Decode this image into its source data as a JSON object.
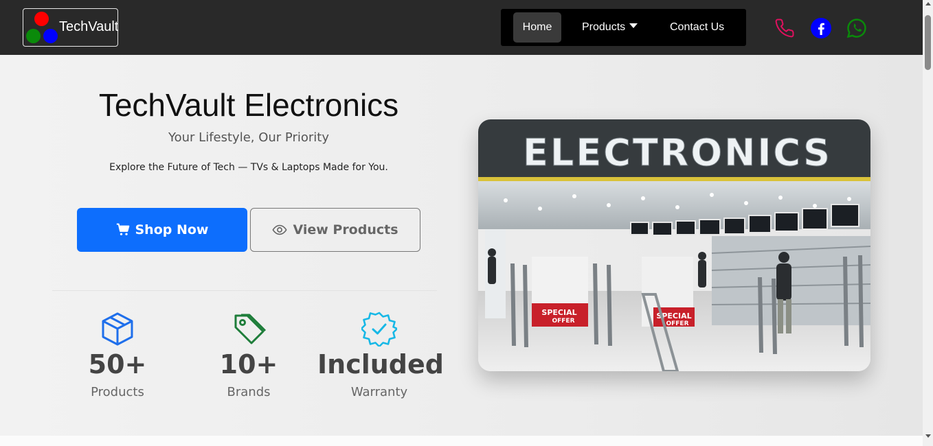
{
  "brand": {
    "name": "TechVault"
  },
  "nav": {
    "home": "Home",
    "products": "Products",
    "contact": "Contact Us"
  },
  "social": {
    "phone_color": "#e0115f",
    "facebook_color": "#0000ff",
    "whatsapp_color": "#0a8a0a"
  },
  "hero": {
    "title": "TechVault Electronics",
    "subtitle": "Your Lifestyle, Our Priority",
    "description": "Explore the Future of Tech — TVs & Laptops Made for You.",
    "shop_button": "Shop Now",
    "view_button": "View Products"
  },
  "stats": [
    {
      "value": "50+",
      "label": "Products",
      "icon": "box-icon",
      "color": "#1f6feb"
    },
    {
      "value": "10+",
      "label": "Brands",
      "icon": "tag-icon",
      "color": "#1e7d3a"
    },
    {
      "value": "Included",
      "label": "Warranty",
      "icon": "badge-check-icon",
      "color": "#17b8e6"
    }
  ],
  "store_image": {
    "sign_text": "ELECTRONICS",
    "offer_text_1": "SPECIAL",
    "offer_text_2": "OFFER"
  },
  "colors": {
    "primary": "#0d6efd",
    "navbar": "#292929"
  }
}
